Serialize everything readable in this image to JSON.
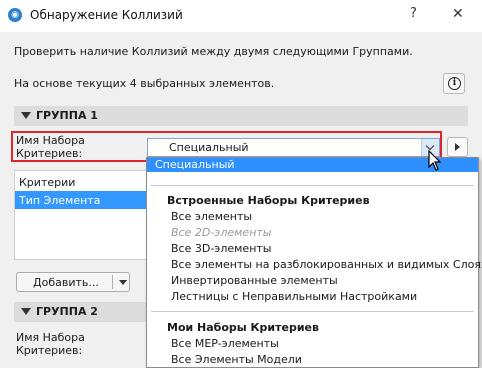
{
  "window": {
    "title": "Обнаружение Коллизий",
    "help_label": "?",
    "close_label": "✕"
  },
  "intro": {
    "line1": "Проверить наличие Коллизий между двумя следующими Группами.",
    "line2": "На основе текущих 4 выбранных элементов.",
    "info_icon": "i"
  },
  "group1": {
    "title": "ГРУППА 1",
    "criteria_set_label": "Имя Набора\nКритериев:",
    "criteria_set_label_line1": "Имя Набора",
    "criteria_set_label_line2": "Критериев:",
    "selected_set": "Специальный",
    "list_header": "Критерии",
    "list_selected_item": "Тип Элемента",
    "add_button": "Добавить..."
  },
  "group2": {
    "title": "ГРУППА 2",
    "criteria_set_label_line1": "Имя Набора",
    "criteria_set_label_line2": "Критериев:"
  },
  "dropdown": {
    "highlighted": "Специальный",
    "builtin_header": "Встроенные Наборы Критериев",
    "builtin_items": [
      {
        "label": "Все элементы",
        "disabled": false
      },
      {
        "label": "Все 2D-элементы",
        "disabled": true
      },
      {
        "label": "Все 3D-элементы",
        "disabled": false
      },
      {
        "label": "Все элементы на разблокированных и видимых Слоях",
        "disabled": false
      },
      {
        "label": "Инвертированные элементы",
        "disabled": false
      },
      {
        "label": "Лестницы с Неправильными Настройками",
        "disabled": false
      }
    ],
    "my_header": "Мои Наборы Критериев",
    "my_items": [
      {
        "label": "Все MEP-элементы"
      },
      {
        "label": "Все Элементы Модели"
      }
    ]
  },
  "colors": {
    "highlight": "#2f8fff",
    "selection": "#3399ff",
    "annotation_border": "#e0262a",
    "group_bar": "#dcdcdc"
  }
}
